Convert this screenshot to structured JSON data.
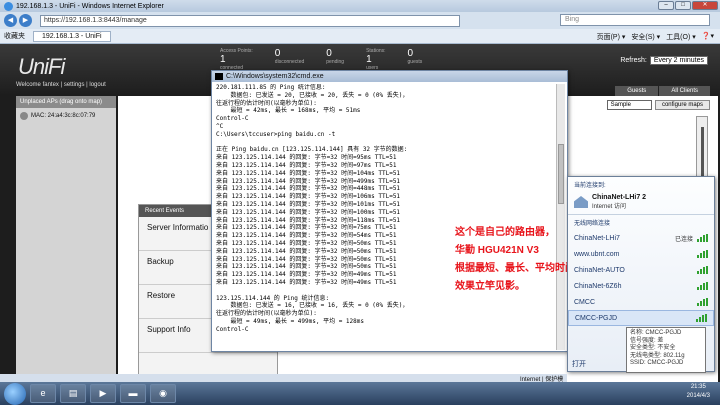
{
  "ie": {
    "title": "192.168.1.3 - UniFi - Windows Internet Explorer",
    "url": "https://192.168.1.3:8443/manage",
    "search_placeholder": "Bing",
    "favorites_label": "收藏夹",
    "tab_label": "192.168.1.3 - UniFi",
    "menus": [
      "页面(P) ▾",
      "安全(S) ▾",
      "工具(O) ▾",
      "❓▾"
    ],
    "status_zone": "Internet | 保护模式: 禁用",
    "zoom": "100%"
  },
  "unifi": {
    "logo": "UniFi",
    "welcome": "Welcome fantex",
    "welcome_links": "| settings | logout",
    "stats": [
      {
        "label_top": "Access Points:",
        "value": "1",
        "label": "connected"
      },
      {
        "label_top": "",
        "value": "0",
        "label": "disconnected"
      },
      {
        "label_top": "",
        "value": "0",
        "label": "pending"
      },
      {
        "label_top": "Stations:",
        "value": "1",
        "label": "users"
      },
      {
        "label_top": "",
        "value": "0",
        "label": "guests"
      }
    ],
    "refresh_label": "Refresh:",
    "refresh_value": "Every 2 minutes",
    "tabs": [
      "Guests",
      "All Clients"
    ],
    "map_label": "ap:",
    "map_select": "Sample",
    "configure_maps": "configure maps",
    "unplaced_header": "Unplaced APs (drag onto map)",
    "unplaced_mac": "MAC: 24:a4:3c:8c:07:79",
    "events_header": "Recent Events",
    "events_rows": [
      "Server Informatio",
      "Backup",
      "Restore",
      "Support Info"
    ]
  },
  "cmd": {
    "title": "C:\\Windows\\system32\\cmd.exe",
    "lines": [
      "220.181.111.85 的 Ping 统计信息:",
      "    数据包: 已发送 = 20, 已接收 = 20, 丢失 = 0 (0% 丢失)，",
      "往返行程的估计时间(以毫秒为单位):",
      "    最短 = 42ms, 最长 = 168ms, 平均 = 51ms",
      "Control-C",
      "^C",
      "C:\\Users\\tccuser>ping baidu.cn -t",
      "",
      "正在 Ping baidu.cn [123.125.114.144] 具有 32 字节的数据:",
      "来自 123.125.114.144 的回复: 字节=32 时间=95ms TTL=51",
      "来自 123.125.114.144 的回复: 字节=32 时间=97ms TTL=51",
      "来自 123.125.114.144 的回复: 字节=32 时间=104ms TTL=51",
      "来自 123.125.114.144 的回复: 字节=32 时间=499ms TTL=51",
      "来自 123.125.114.144 的回复: 字节=32 时间=448ms TTL=51",
      "来自 123.125.114.144 的回复: 字节=32 时间=106ms TTL=51",
      "来自 123.125.114.144 的回复: 字节=32 时间=101ms TTL=51",
      "来自 123.125.114.144 的回复: 字节=32 时间=100ms TTL=51",
      "来自 123.125.114.144 的回复: 字节=32 时间=118ms TTL=51",
      "来自 123.125.114.144 的回复: 字节=32 时间=75ms TTL=51",
      "来自 123.125.114.144 的回复: 字节=32 时间=54ms TTL=51",
      "来自 123.125.114.144 的回复: 字节=32 时间=50ms TTL=51",
      "来自 123.125.114.144 的回复: 字节=32 时间=50ms TTL=51",
      "来自 123.125.114.144 的回复: 字节=32 时间=50ms TTL=51",
      "来自 123.125.114.144 的回复: 字节=32 时间=50ms TTL=51",
      "来自 123.125.114.144 的回复: 字节=32 时间=49ms TTL=51",
      "来自 123.125.114.144 的回复: 字节=32 时间=49ms TTL=51",
      "",
      "123.125.114.144 的 Ping 统计信息:",
      "    数据包: 已发送 = 16, 已接收 = 16, 丢失 = 0 (0% 丢失)，",
      "往返行程的估计时间(以毫秒为单位):",
      "    最短 = 49ms, 最长 = 499ms, 平均 = 128ms",
      "Control-C"
    ]
  },
  "annotation": [
    "这个是自己的路由器，",
    "华勤 HGU421N V3",
    "根据最短、最长、平均时间",
    "效果立竿见影。"
  ],
  "network": {
    "header": "当前连接到:",
    "connected_name": "ChinaNet-LHi7 2",
    "connected_status": "Internet 访问",
    "section": "无线网络连接",
    "items": [
      {
        "name": "ChinaNet-LHi7",
        "status": "已连接"
      },
      {
        "name": "www.ubnt.com",
        "status": ""
      },
      {
        "name": "ChinaNet-AUTO",
        "status": ""
      },
      {
        "name": "ChinaNet-6Z6h",
        "status": ""
      },
      {
        "name": "CMCC",
        "status": ""
      },
      {
        "name": "CMCC-PGJD",
        "status": ""
      }
    ],
    "tooltip": [
      "名称: CMCC-PGJD",
      "信号强度: 差",
      "安全类型: 不安全",
      "无线电类型: 802.11g",
      "SSID: CMCC-PGJD"
    ],
    "footer": "打开"
  },
  "taskbar": {
    "time": "21:35",
    "date": "2014/4/3"
  }
}
